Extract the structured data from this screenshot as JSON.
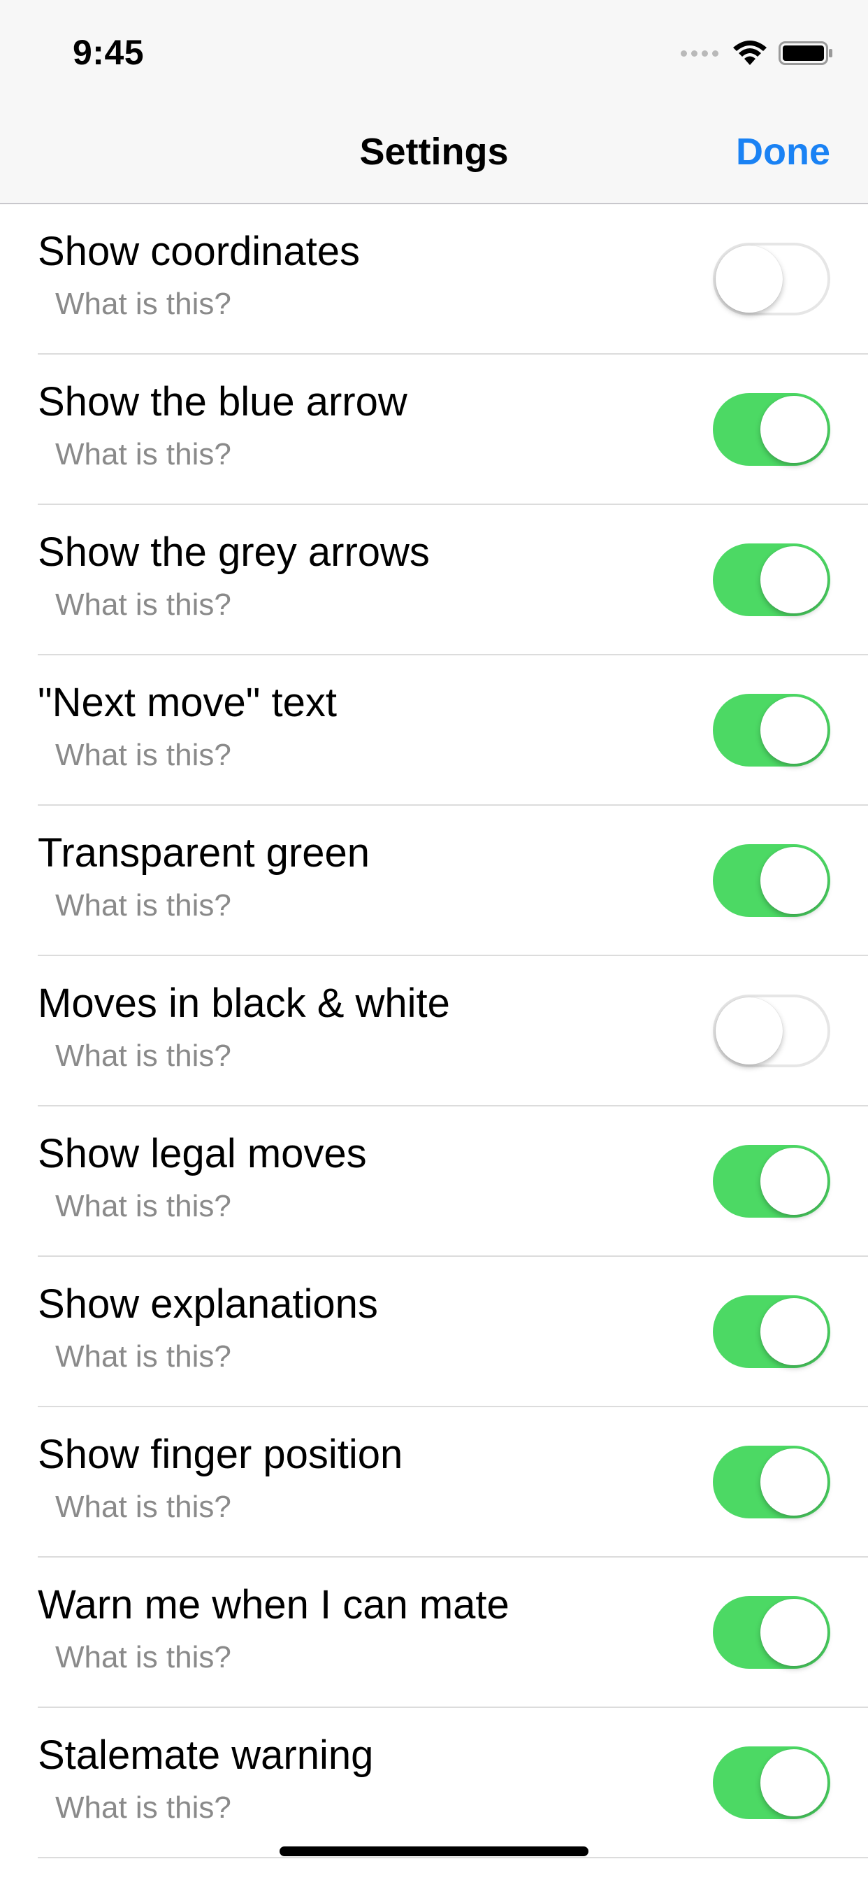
{
  "status": {
    "time": "9:45"
  },
  "nav": {
    "title": "Settings",
    "done_label": "Done"
  },
  "colors": {
    "accent": "#1a82f4",
    "toggle_on": "#4cd964",
    "help_text": "#8a8a8a"
  },
  "settings": [
    {
      "label": "Show coordinates",
      "help": "What is this?",
      "on": false
    },
    {
      "label": "Show the blue arrow",
      "help": "What is this?",
      "on": true
    },
    {
      "label": "Show the grey arrows",
      "help": "What is this?",
      "on": true
    },
    {
      "label": "\"Next move\" text",
      "help": "What is this?",
      "on": true
    },
    {
      "label": "Transparent green",
      "help": "What is this?",
      "on": true
    },
    {
      "label": "Moves in black & white",
      "help": "What is this?",
      "on": false
    },
    {
      "label": "Show legal moves",
      "help": "What is this?",
      "on": true
    },
    {
      "label": "Show explanations",
      "help": "What is this?",
      "on": true
    },
    {
      "label": "Show finger position",
      "help": "What is this?",
      "on": true
    },
    {
      "label": "Warn me when I can mate",
      "help": "What is this?",
      "on": true
    },
    {
      "label": "Stalemate warning",
      "help": "What is this?",
      "on": true
    }
  ]
}
